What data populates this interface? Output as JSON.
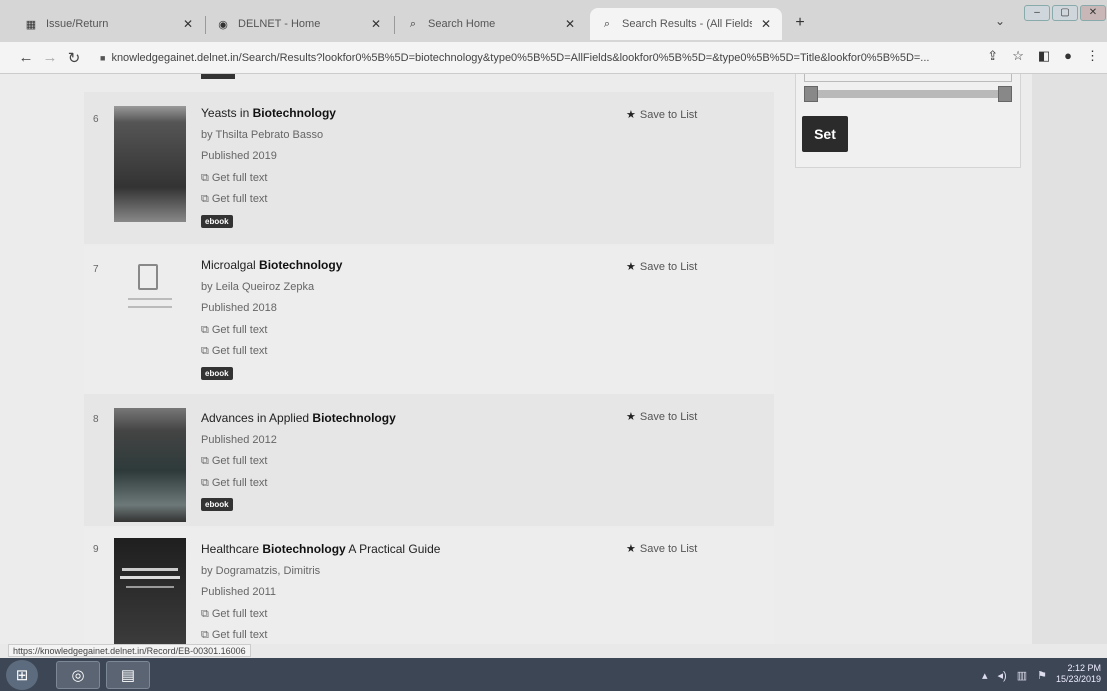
{
  "tabs": [
    {
      "title": "Issue/Return",
      "active": false
    },
    {
      "title": "DELNET - Home",
      "active": false
    },
    {
      "title": "Search Home",
      "active": false
    },
    {
      "title": "Search Results - (All Fields:biotec",
      "active": true
    }
  ],
  "new_tab_glyph": "+",
  "tab_search_glyph": "⌄",
  "address_url": "knowledgegainet.delnet.in/Search/Results?lookfor0%5B%5D=biotechnology&type0%5B%5D=AllFields&lookfor0%5B%5D=&type0%5B%5D=Title&lookfor0%5B%5D=...",
  "results": [
    {
      "number": "6",
      "title_prefix": "Yeasts in",
      "title_bold": "Biotechnology",
      "title_suffix": "",
      "author": "by Thsilta Pebrato Basso",
      "published": "Published 2019",
      "links": [
        "Get full text",
        "Get full text"
      ],
      "badge": "ebook",
      "save": "Save to List"
    },
    {
      "number": "7",
      "title_prefix": "Microalgal",
      "title_bold": "Biotechnology",
      "title_suffix": "",
      "author": "by Leila Queiroz Zepka",
      "published": "Published 2018",
      "links": [
        "Get full text",
        "Get full text"
      ],
      "badge": "ebook",
      "save": "Save to List"
    },
    {
      "number": "8",
      "title_prefix": "Advances in Applied",
      "title_bold": "Biotechnology",
      "title_suffix": "",
      "published": "Published 2012",
      "links": [
        "Get full text",
        "Get full text"
      ],
      "badge": "ebook",
      "save": "Save to List"
    },
    {
      "number": "9",
      "title_prefix": "Healthcare",
      "title_bold": "Biotechnology",
      "title_suffix": "A Practical Guide",
      "author": "by Dogramatzis, Dimitris",
      "published": "Published 2011",
      "links": [
        "Get full text",
        "Get full text"
      ],
      "save": "Save to List"
    }
  ],
  "sidebar": {
    "set_button": "Set"
  },
  "status_url": "https://knowledgegainet.delnet.in/Record/EB-00301.16006",
  "taskbar": {
    "clock_time": "2:12 PM",
    "clock_date": "15/23/2019"
  },
  "colors": {
    "set_button_bg": "#2b2b2b",
    "badge_bg": "#333333",
    "taskbar_bg": "#3d4654"
  }
}
